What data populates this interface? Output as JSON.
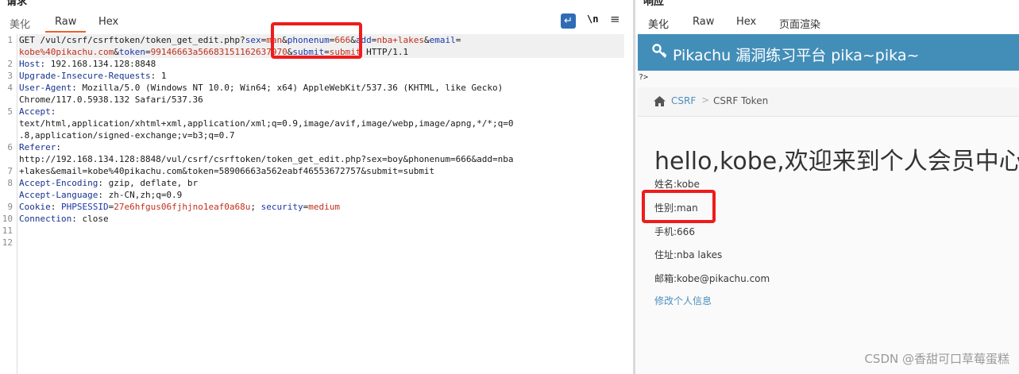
{
  "request_pane": {
    "title": "请求",
    "tabs": [
      "美化",
      "Raw",
      "Hex"
    ],
    "active_tab": "Raw",
    "tools": {
      "wrap": "↵",
      "newline": "\\n",
      "menu": "≡"
    },
    "line_numbers": [
      "1",
      "2",
      "3",
      "4",
      "5",
      "6",
      "7",
      "8",
      "9",
      "10",
      "11",
      "12"
    ]
  },
  "request_lines": {
    "l1a_get": "GET /vul/csrf/csrftoken/token_get_edit.php?",
    "l1a_sex_k": "sex",
    "l1a_sex_v": "man",
    "l1a_amp1": "&",
    "l1a_phone_k": "phonenum",
    "l1a_phone_v": "666",
    "l1a_amp2": "&",
    "l1a_add_k": "add",
    "l1a_add_v": "nba+lakes",
    "l1a_amp3": "&",
    "l1a_email_k": "email",
    "l1a_eq": "=",
    "l1b_email_v": "kobe%40pikachu.com",
    "l1b_amp4": "&",
    "l1b_token_k": "token",
    "l1b_token_v": "99146663a56683151162637970",
    "l1b_amp5": "&",
    "l1b_submit_k": "submit",
    "l1b_submit_v": "submit",
    "l1b_http": " HTTP/1.1",
    "host_k": "Host",
    "host_v": ": 192.168.134.128:8848",
    "uir_k": "Upgrade-Insecure-Requests",
    "uir_v": ": 1",
    "ua_k": "User-Agent",
    "ua_v": ": Mozilla/5.0 (Windows NT 10.0; Win64; x64) AppleWebKit/537.36 (KHTML, like Gecko)",
    "ua_v2": "Chrome/117.0.5938.132 Safari/537.36",
    "accept_k": "Accept",
    "accept_v": ":",
    "accept_v2": "text/html,application/xhtml+xml,application/xml;q=0.9,image/avif,image/webp,image/apng,*/*;q=0",
    "accept_v3": ".8,application/signed-exchange;v=b3;q=0.7",
    "ref_k": "Referer",
    "ref_v": ":",
    "ref_v2": "http://192.168.134.128:8848/vul/csrf/csrftoken/token_get_edit.php?sex=boy&phonenum=666&add=nba",
    "ref_v3": "+lakes&email=kobe%40pikachu.com&token=58906663a562eabf46553672757&submit=submit",
    "ae_k": "Accept-Encoding",
    "ae_v": ": gzip, deflate, br",
    "al_k": "Accept-Language",
    "al_v": ": zh-CN,zh;q=0.9",
    "cookie_k": "Cookie",
    "cookie_sep": ": ",
    "cookie_phpsess_k": "PHPSESSID",
    "cookie_phpsess_v": "27e6hfgus06fjhjno1eaf0a68u",
    "cookie_semi": "; ",
    "cookie_sec_k": "security",
    "cookie_sec_v": "medium",
    "conn_k": "Connection",
    "conn_v": ": close"
  },
  "response_pane": {
    "title": "响应",
    "tabs": [
      "美化",
      "Raw",
      "Hex",
      "页面渲染"
    ],
    "active_tab": "页面渲染"
  },
  "rendered_page": {
    "header_title": "Pikachu 漏洞练习平台 pika~pika~",
    "stray_text": "?>",
    "breadcrumb_link": "CSRF",
    "breadcrumb_sep": ">",
    "breadcrumb_current": "CSRF Token",
    "welcome": "hello,kobe,欢迎来到个人会员中心",
    "name": "姓名:kobe",
    "gender": "性别:man",
    "phone": "手机:666",
    "address": "住址:nba lakes",
    "email": "邮箱:kobe@pikachu.com",
    "edit_link": "修改个人信息"
  },
  "watermark": "CSDN @香甜可口草莓蛋糕",
  "colors": {
    "active_tab_underline": "#e8612c",
    "highlight_box": "#ee1c1c",
    "header_blue": "#438eb9",
    "link_blue": "#4c8fbd",
    "param_name": "#1b38a8",
    "param_value": "#c0301c"
  }
}
